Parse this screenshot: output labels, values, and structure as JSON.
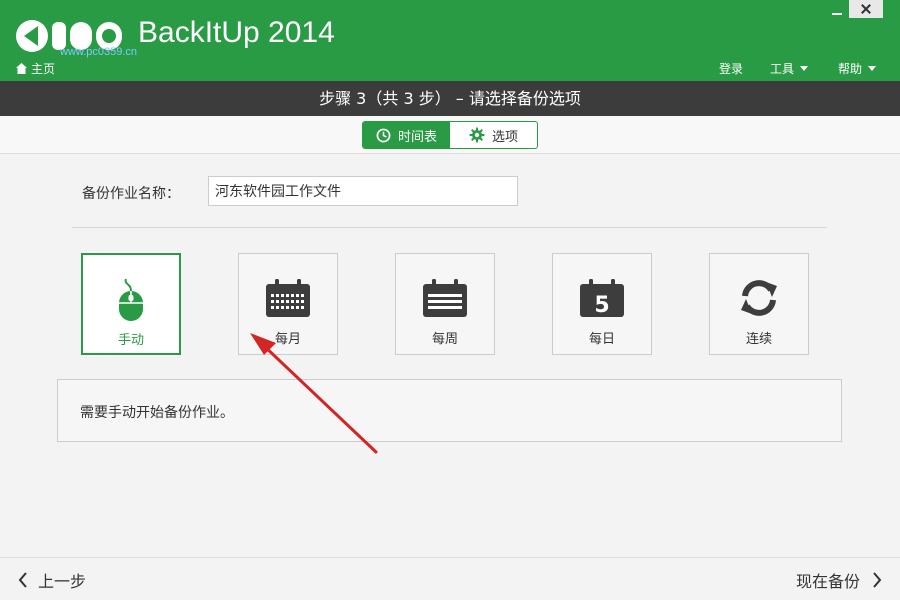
{
  "app": {
    "title": "BackItUp 2014",
    "watermark": "www.pc0359.cn",
    "home_label": "主页"
  },
  "menus": {
    "login": "登录",
    "tools": "工具",
    "help": "帮助"
  },
  "step": {
    "title": "步骤 3（共 3 步） – 请选择备份选项"
  },
  "tabs": [
    {
      "label": "时间表",
      "icon": "clock-icon",
      "active": true
    },
    {
      "label": "选项",
      "icon": "gear-icon",
      "active": false
    }
  ],
  "job": {
    "name_label": "备份作业名称：",
    "name_value": "河东软件园工作文件"
  },
  "schedules": [
    {
      "label": "手动",
      "icon": "mouse-icon",
      "selected": true
    },
    {
      "label": "每月",
      "icon": "calendar-month-icon",
      "selected": false
    },
    {
      "label": "每周",
      "icon": "calendar-week-icon",
      "selected": false
    },
    {
      "label": "每日",
      "icon": "calendar-day-icon",
      "selected": false,
      "day_number": "5"
    },
    {
      "label": "连续",
      "icon": "refresh-icon",
      "selected": false
    }
  ],
  "description": "需要手动开始备份作业。",
  "footer": {
    "prev_label": "上一步",
    "next_label": "现在备份"
  },
  "colors": {
    "brand_green": "#2a9b45",
    "step_bar": "#3c3c3c",
    "icon_dark": "#3d3d3d",
    "annotation_arrow": "#d42525"
  }
}
